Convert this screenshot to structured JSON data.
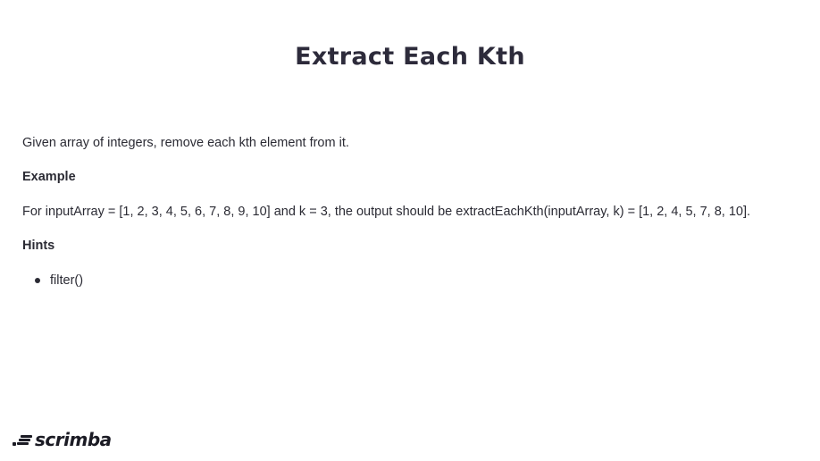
{
  "title": "Extract Each Kth",
  "description": "Given array of integers, remove each kth element from it.",
  "example": {
    "heading": "Example",
    "text": "For inputArray = [1, 2, 3, 4, 5, 6, 7, 8, 9, 10] and k = 3, the output should be extractEachKth(inputArray, k) = [1, 2, 4, 5, 7, 8, 10]."
  },
  "hints": {
    "heading": "Hints",
    "items": [
      "filter()"
    ]
  },
  "brand": {
    "name": "scrimba",
    "icon": "scrimba-logo-icon"
  }
}
